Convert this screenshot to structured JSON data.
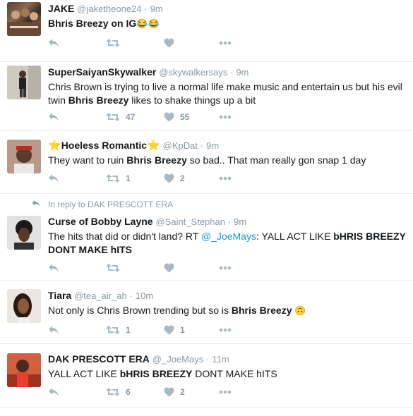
{
  "tweets": [
    {
      "name": "JAKE",
      "handle": "@jaketheone24",
      "dot": "·",
      "time": "9m",
      "text_pre": "",
      "bold": "Bhris Breezy",
      "text_post": " on IG",
      "emojis": "😂😂",
      "replies": "",
      "retweets": "",
      "likes": ""
    },
    {
      "name": "SuperSaiyanSkywalker",
      "handle": "@skywalkersays",
      "dot": "·",
      "time": "9m",
      "text_pre": "Chris Brown is trying to live a normal life make music and entertain us but his evil twin ",
      "bold": "Bhris Breezy",
      "text_post": " likes to shake things up a bit",
      "replies": "",
      "retweets": "47",
      "likes": "55"
    },
    {
      "name_star": "⭐",
      "name": "Hoeless Romantic",
      "name_star_after": "⭐",
      "handle": "@KpDat",
      "dot": "·",
      "time": "9m",
      "text_pre": "They want to ruin ",
      "bold": "Bhris Breezy",
      "text_post": " so bad.. That man really gon snap 1 day",
      "replies": "",
      "retweets": "1",
      "likes": "2"
    },
    {
      "reply_context": "In reply to DAK PRESCOTT ERA",
      "name": "Curse of Bobby Layne",
      "handle": "@Saint_Stephan",
      "dot": "·",
      "time": "9m",
      "text_pre": "The hits that did or didn't land? RT ",
      "mention": "@_JoeMays",
      "text_mid": ": YALL ACT LIKE ",
      "bold": "bHRIS BREEZY",
      "text_post": " DONT MAKE hITS",
      "replies": "",
      "retweets": "",
      "likes": ""
    },
    {
      "name": "Tiara",
      "handle": "@tea_air_ah",
      "dot": "·",
      "time": "10m",
      "text_pre": "Not only is Chris Brown trending but so is ",
      "bold": "Bhris Breezy",
      "text_post": "",
      "emojis": "🙃",
      "replies": "",
      "retweets": "1",
      "likes": "1"
    },
    {
      "name": "DAK PRESCOTT ERA",
      "handle": "@_JoeMays",
      "dot": "·",
      "time": "11m",
      "text_pre": "YALL ACT LIKE ",
      "bold": "bHRIS BREEZY",
      "text_post": " DONT MAKE hITS",
      "replies": "",
      "retweets": "6",
      "likes": "2"
    }
  ],
  "icons": {
    "reply": "reply-icon",
    "retweet": "retweet-icon",
    "like": "heart-icon",
    "more": "more-icon"
  },
  "colors": {
    "action": "#aab8c2",
    "link": "#1b95e0",
    "meta": "#8899a6",
    "divider": "#e6ecf0"
  }
}
